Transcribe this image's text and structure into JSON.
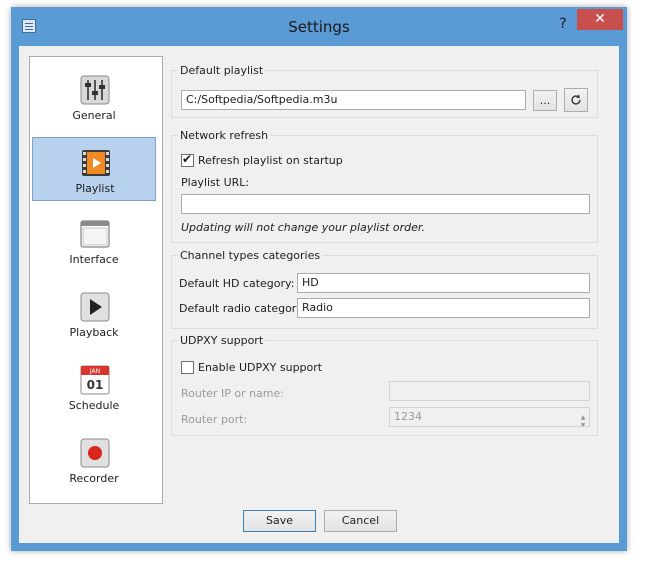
{
  "window": {
    "title": "Settings",
    "help": "?",
    "close": "✕"
  },
  "sidebar": {
    "items": [
      {
        "label": "General",
        "icon": "sliders-icon"
      },
      {
        "label": "Playlist",
        "icon": "film-icon",
        "active": true
      },
      {
        "label": "Interface",
        "icon": "window-icon"
      },
      {
        "label": "Playback",
        "icon": "play-icon"
      },
      {
        "label": "Schedule",
        "icon": "calendar-icon",
        "calendar_month": "JAN",
        "calendar_day": "01"
      },
      {
        "label": "Recorder",
        "icon": "record-icon"
      }
    ]
  },
  "default_playlist": {
    "title": "Default playlist",
    "path": "C:/Softpedia/Softpedia.m3u",
    "browse_label": "...",
    "reset_icon": "refresh-icon"
  },
  "network_refresh": {
    "title": "Network refresh",
    "refresh_checkbox_label": "Refresh playlist on startup",
    "refresh_checked": true,
    "url_label": "Playlist URL:",
    "url_value": "",
    "note": "Updating will not change your playlist order."
  },
  "channel_types": {
    "title": "Channel types categories",
    "hd_label": "Default HD category:",
    "hd_value": "HD",
    "radio_label": "Default radio category:",
    "radio_value": "Radio"
  },
  "udpxy": {
    "title": "UDPXY support",
    "enable_label": "Enable UDPXY support",
    "enabled": false,
    "router_ip_label": "Router IP or name:",
    "router_ip_value": "",
    "router_port_label": "Router port:",
    "router_port_value": "1234"
  },
  "buttons": {
    "save": "Save",
    "cancel": "Cancel"
  },
  "colors": {
    "title_bar": "#5b9bd5",
    "close": "#c7504d",
    "selection": "#b8d1ec",
    "dialog_bg": "#f0f0f0"
  }
}
